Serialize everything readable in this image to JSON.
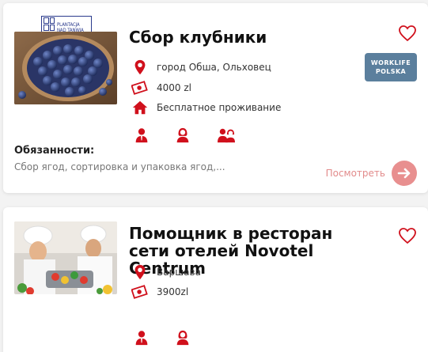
{
  "listings": [
    {
      "title": "Сбор клубники",
      "logo_text": [
        "PLANTACJA",
        "NAD TANWIĄ"
      ],
      "badge_lines": [
        "WORKLIFE",
        "POLSKA"
      ],
      "location": "город Обша, Ольховец",
      "salary": "4000 zl",
      "housing": "Бесплатное проживание",
      "duties_label": "Обязанности:",
      "duties_text": "Сбор ягод, сортировка и упаковка ягод,...",
      "view_label": "Посмотреть",
      "icons": [
        "location-pin-icon",
        "money-icon",
        "home-icon",
        "male-worker-icon",
        "female-worker-icon",
        "couple-icon",
        "heart-icon",
        "arrow-right-icon"
      ]
    },
    {
      "title": "Помощник в ресторан сети отелей Novotel Centrum",
      "location": "Варшава",
      "salary": "3900zl",
      "icons": [
        "location-pin-icon",
        "money-icon",
        "male-worker-icon",
        "female-worker-icon",
        "heart-icon"
      ]
    }
  ],
  "colors": {
    "accent_red": "#d0101c",
    "badge_blue": "#5b7f9d",
    "view_pink": "#e88f8f"
  }
}
